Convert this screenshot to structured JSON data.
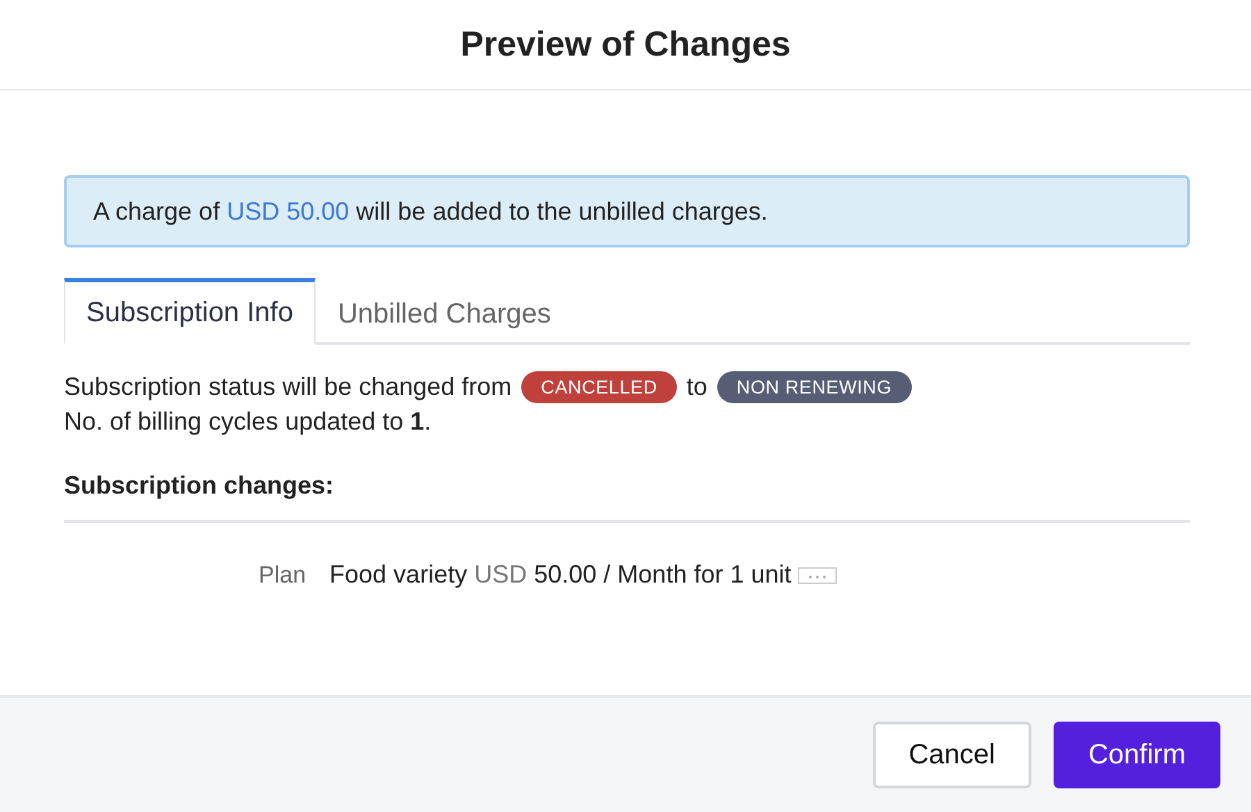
{
  "dialog": {
    "title": "Preview of Changes"
  },
  "notice": {
    "before": "A charge of",
    "amount": "USD 50.00",
    "after": "will be added to the unbilled charges."
  },
  "tabs": [
    {
      "label": "Subscription Info",
      "selected": true
    },
    {
      "label": "Unbilled Charges",
      "selected": false
    }
  ],
  "status_change": {
    "text_from": "Subscription status will be changed from",
    "from": {
      "label": "CANCELLED",
      "color": "#c0413b"
    },
    "text_to": "to",
    "to": {
      "label": "NON RENEWING",
      "color": "#565d75"
    }
  },
  "billing_cycles": "No. of billing cycles updated to **1**.",
  "changes_heading": "Subscription changes:",
  "changes": [
    {
      "label": "Plan",
      "name": "Food variety",
      "currency": "USD",
      "detail": "50.00 / Month for 1 unit",
      "more": true
    }
  ],
  "buttons": [
    {
      "label": "Cancel",
      "kind": "secondary"
    },
    {
      "label": "Confirm",
      "kind": "primary"
    }
  ]
}
